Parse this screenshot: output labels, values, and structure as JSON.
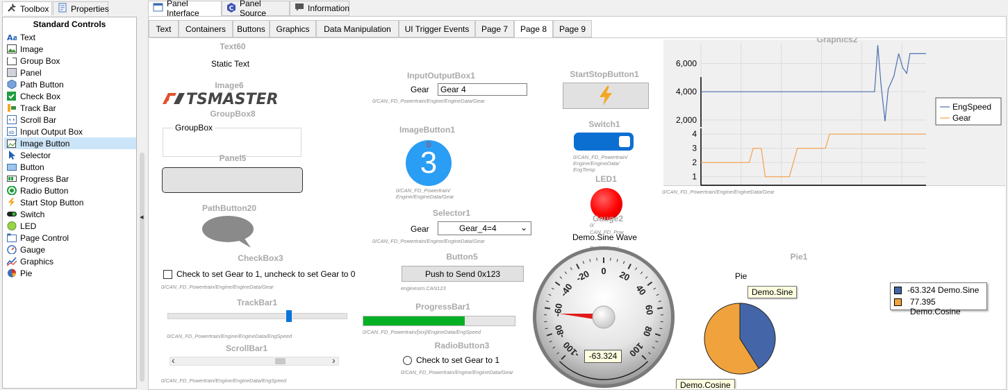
{
  "left_tabs": {
    "toolbox": "Toolbox",
    "properties": "Properties"
  },
  "toolbox": {
    "title": "Standard Controls",
    "items": [
      {
        "label": "Text",
        "icon": "text-icon"
      },
      {
        "label": "Image",
        "icon": "image-icon"
      },
      {
        "label": "Group Box",
        "icon": "groupbox-icon"
      },
      {
        "label": "Panel",
        "icon": "panel-icon"
      },
      {
        "label": "Path Button",
        "icon": "hexagon-icon"
      },
      {
        "label": "Check Box",
        "icon": "checkbox-icon"
      },
      {
        "label": "Track Bar",
        "icon": "trackbar-icon"
      },
      {
        "label": "Scroll Bar",
        "icon": "scrollbar-icon"
      },
      {
        "label": "Input Output Box",
        "icon": "io-box-icon"
      },
      {
        "label": "Image Button",
        "icon": "image-button-icon"
      },
      {
        "label": "Selector",
        "icon": "cursor-icon"
      },
      {
        "label": "Button",
        "icon": "button-icon"
      },
      {
        "label": "Progress Bar",
        "icon": "progressbar-icon"
      },
      {
        "label": "Radio Button",
        "icon": "radio-icon"
      },
      {
        "label": "Start Stop Button",
        "icon": "lightning-icon"
      },
      {
        "label": "Switch",
        "icon": "switch-icon"
      },
      {
        "label": "LED",
        "icon": "led-icon"
      },
      {
        "label": "Page Control",
        "icon": "page-control-icon"
      },
      {
        "label": "Gauge",
        "icon": "gauge-icon"
      },
      {
        "label": "Graphics",
        "icon": "graphics-icon"
      },
      {
        "label": "Pie",
        "icon": "pie-icon"
      }
    ],
    "selected_index": 9
  },
  "main_tabs": [
    "Panel Interface",
    "Panel Source",
    "Information"
  ],
  "page_tabs": [
    "Text",
    "Containers",
    "Buttons",
    "Graphics",
    "Data Manipulation",
    "UI Trigger Events",
    "Page 7",
    "Page 8",
    "Page 9"
  ],
  "active_page_tab": "Page 8",
  "controls": {
    "text60": {
      "title": "Text60",
      "text": "Static Text"
    },
    "image6": {
      "title": "Image6",
      "logo_text": "TSMASTER"
    },
    "groupbox8": {
      "title": "GroupBox8",
      "caption": "GroupBox"
    },
    "panel5": {
      "title": "Panel5"
    },
    "pathbutton20": {
      "title": "PathButton20"
    },
    "checkbox3": {
      "title": "CheckBox3",
      "label": "Check to set Gear to 1, uncheck to set Gear to 0",
      "path": "0/CAN_FD_Powertrain/Engine/EngineData/Gear",
      "checked": false
    },
    "trackbar1": {
      "title": "TrackBar1",
      "path": "0/CAN_FD_Powertrain/Engine/EngineData/EngSpeed",
      "position": 0.68
    },
    "scrollbar1": {
      "title": "ScrollBar1",
      "path": "0/CAN_FD_Powertrain/Engine/EngineData/EngSpeed",
      "left_arrow": "‹",
      "right_arrow": "›"
    },
    "ioBox1": {
      "title": "InputOutputBox1",
      "label": "Gear",
      "value": "Gear 4",
      "path": "0/CAN_FD_Powertrain/Engine/EngineData/Gear"
    },
    "imagebutton1": {
      "title": "ImageButton1",
      "top_number": "0",
      "big_number": "3",
      "path1": "0/CAN_FD_Powertrain/",
      "path2": "Engine/EngineData/Gear"
    },
    "selector1": {
      "title": "Selector1",
      "label": "Gear",
      "value": "Gear_4=4",
      "path": "0/CAN_FD_Powertrain/Engine/EngineData/Gear"
    },
    "button5": {
      "title": "Button5",
      "label": "Push to Send 0x123",
      "path": "enginesim.CAN123"
    },
    "progressbar1": {
      "title": "ProgressBar1",
      "path": "0/CAN_FD_Powertrain/[ixx]/EngineData/EngSpeed",
      "progress": 0.67
    },
    "radiobutton3": {
      "title": "RadioButton3",
      "label": "Check to set Gear to 1",
      "path": "0/CAN_FD_Powertrain/Engine/EngineData/Gear",
      "checked": false
    },
    "startstop1": {
      "title": "StartStopButton1"
    },
    "switch1": {
      "title": "Switch1",
      "path1": "0/CAN_FD_Powertrain/",
      "path2": "Engine/EngineData/",
      "path3": "EngTemp",
      "on": true
    },
    "led1": {
      "title": "LED1",
      "color": "#ff0000"
    },
    "gauge2": {
      "title": "Gauge2",
      "caption": "Demo.Sine Wave",
      "value_label": "-63.324",
      "path1": "0/",
      "path2": "CAN_FD_Pow",
      "path3": "EngineData/"
    },
    "pie1": {
      "title": "Pie1",
      "caption": "Pie",
      "tooltip_sine": "Demo.Sine",
      "tooltip_cosine": "Demo.Cosine"
    },
    "graphics2": {
      "title": "Graphics2",
      "path": "0/CAN_FD_Powertrain/Engine/EngineData/Gear"
    }
  },
  "colors": {
    "accent_blue": "#1e90ff",
    "switch_blue": "#0a6fd1",
    "progress_green": "#06b025",
    "engspeed_line": "#4a6eae",
    "gear_line": "#f5a04a",
    "pie_blue": "#4466a8",
    "pie_orange": "#f0a23c"
  },
  "chart_data": [
    {
      "type": "line",
      "title": "Graphics2",
      "x_ticks": [
        "0",
        "5",
        "10",
        "15",
        "20",
        "25"
      ],
      "xlim": [
        0,
        28
      ],
      "legend": [
        "EngSpeed",
        "Gear"
      ],
      "top_panel": {
        "y_ticks": [
          "6,000",
          "4,000",
          "2,000"
        ],
        "ylim": [
          1500,
          7500
        ],
        "series": [
          {
            "name": "EngSpeed",
            "x": [
              0,
              21.6,
              22.0,
              22.4,
              22.9,
              23.3,
              24.0,
              24.6,
              25.1,
              25.6,
              26.0,
              26.6,
              28
            ],
            "y": [
              4000,
              4000,
              7300,
              4500,
              1900,
              4200,
              5100,
              6700,
              5700,
              5300,
              6700,
              6700,
              6700
            ]
          }
        ]
      },
      "bottom_panel": {
        "y_ticks": [
          "4",
          "3",
          "2",
          "1"
        ],
        "ylim": [
          0.4,
          4.4
        ],
        "series": [
          {
            "name": "Gear",
            "x": [
              0,
              6,
              6.5,
              7.5,
              8,
              11,
              11.5,
              12,
              15.5,
              16,
              28
            ],
            "y": [
              2,
              2,
              3,
              3,
              1,
              1,
              2,
              3,
              3,
              4,
              4
            ]
          }
        ]
      }
    },
    {
      "type": "pie",
      "title": "Pie",
      "legend": [
        "-63.324 Demo.Sine",
        "77.395 Demo.Cosine"
      ],
      "series": [
        {
          "name": "Demo.Sine",
          "value": -63.324
        },
        {
          "name": "Demo.Cosine",
          "value": 77.395
        }
      ],
      "display_fractions": [
        0.41,
        0.59
      ]
    },
    {
      "type": "gauge",
      "title": "Demo.Sine Wave",
      "min": -100,
      "max": 100,
      "ticks": [
        "-100",
        "-80",
        "-60",
        "-40",
        "-20",
        "0",
        "20",
        "40",
        "60",
        "80",
        "100"
      ],
      "value": -63.324
    }
  ]
}
